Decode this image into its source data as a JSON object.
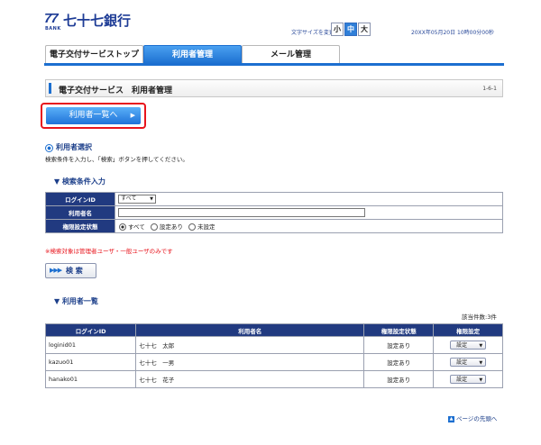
{
  "header": {
    "logo_mark": "77",
    "logo_bank": "BANK",
    "bank_name": "七十七銀行",
    "font_size_label": "文字サイズを変更",
    "font_sizes": [
      "小",
      "中",
      "大"
    ],
    "font_size_selected": "中",
    "datetime": "20XX年05月20日 10時00分00秒"
  },
  "tabs": [
    {
      "label": "電子交付サービストップ",
      "active": false
    },
    {
      "label": "利用者管理",
      "active": true
    },
    {
      "label": "メール管理",
      "active": false
    }
  ],
  "page": {
    "title": "電子交付サービス　利用者管理",
    "screen_no": "1-6-1",
    "userlist_button": "利用者一覧へ"
  },
  "selection": {
    "heading": "利用者選択",
    "instruction": "検索条件を入力し、「検索」ボタンを押してください。"
  },
  "search": {
    "heading": "▼ 検索条件入力",
    "login_id_label": "ログインID",
    "login_id_value": "すべて",
    "user_name_label": "利用者名",
    "user_name_value": "",
    "auth_status_label": "権限設定状態",
    "auth_options": [
      "すべて",
      "設定あり",
      "未設定"
    ],
    "auth_selected": "すべて",
    "note": "※検索対象は管理者ユーザ・一般ユーザのみです",
    "search_button": "検 索"
  },
  "results": {
    "heading": "▼ 利用者一覧",
    "count": "該当件数:3件",
    "columns": [
      "ログインID",
      "利用者名",
      "権限設定状態",
      "権限設定"
    ],
    "rows": [
      {
        "login_id": "loginid01",
        "name": "七十七　太郎",
        "status": "設定あり",
        "action": "設定"
      },
      {
        "login_id": "kazuo01",
        "name": "七十七　一男",
        "status": "設定あり",
        "action": "設定"
      },
      {
        "login_id": "hanako01",
        "name": "七十七　花子",
        "status": "設定あり",
        "action": "設定"
      }
    ]
  },
  "footer": {
    "page_top": "ページの先頭へ"
  },
  "colors": {
    "accent": "#1c6fd0",
    "header_cell": "#213a80",
    "highlight": "#e8141c"
  }
}
